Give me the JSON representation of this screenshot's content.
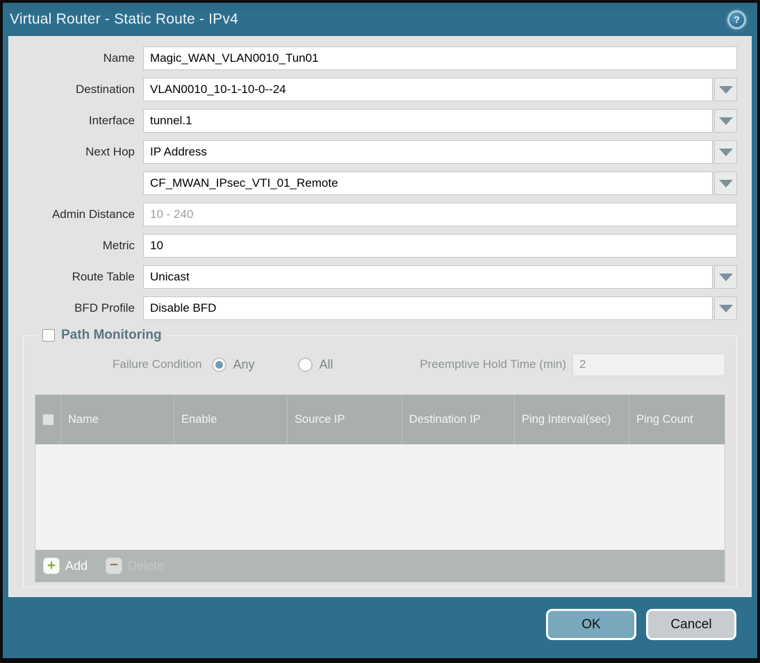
{
  "dialog": {
    "title": "Virtual Router - Static Route - IPv4",
    "help_icon_glyph": "?"
  },
  "form": {
    "fields": [
      {
        "label": "Name",
        "value": "Magic_WAN_VLAN0010_Tun01",
        "type": "text"
      },
      {
        "label": "Destination",
        "value": "VLAN0010_10-1-10-0--24",
        "type": "dropdown"
      },
      {
        "label": "Interface",
        "value": "tunnel.1",
        "type": "dropdown"
      },
      {
        "label": "Next Hop",
        "value": "IP Address",
        "type": "dropdown"
      },
      {
        "label": "",
        "value": "CF_MWAN_IPsec_VTI_01_Remote",
        "type": "dropdown"
      },
      {
        "label": "Admin Distance",
        "value": "",
        "placeholder": "10 - 240",
        "type": "text"
      },
      {
        "label": "Metric",
        "value": "10",
        "type": "text"
      },
      {
        "label": "Route Table",
        "value": "Unicast",
        "type": "dropdown"
      },
      {
        "label": "BFD Profile",
        "value": "Disable BFD",
        "type": "dropdown"
      }
    ]
  },
  "path_monitoring": {
    "label": "Path Monitoring",
    "checked": false,
    "failure_condition": {
      "label": "Failure Condition",
      "options": [
        {
          "label": "Any",
          "selected": true
        },
        {
          "label": "All",
          "selected": false
        }
      ]
    },
    "preemptive_hold_time": {
      "label": "Preemptive Hold Time (min)",
      "value": "2"
    },
    "table": {
      "columns": [
        "Name",
        "Enable",
        "Source IP",
        "Destination IP",
        "Ping Interval(sec)",
        "Ping Count"
      ],
      "rows": [],
      "add_label": "Add",
      "delete_label": "Delete"
    }
  },
  "footer": {
    "ok_label": "OK",
    "cancel_label": "Cancel"
  },
  "colors": {
    "frame_teal": "#2e6f8e",
    "content_bg": "#e3e3e3",
    "table_header_bg": "#a9aeae",
    "ok_button": "#78a8bb",
    "cancel_button": "#c8cccf",
    "radio_selected": "#6f9db1",
    "add_icon_green": "#8fab3f",
    "delete_icon_red": "#a8625a"
  }
}
